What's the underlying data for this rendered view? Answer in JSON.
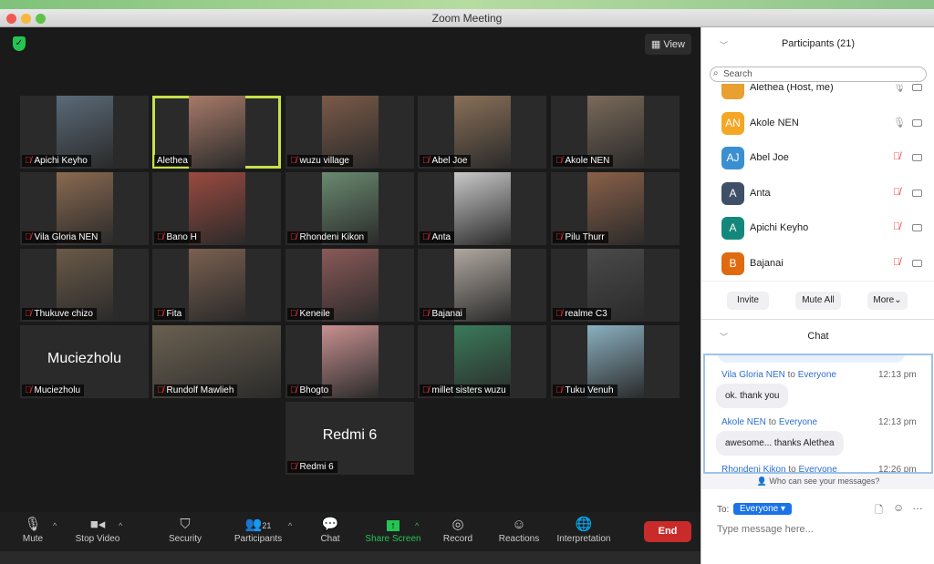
{
  "window": {
    "title": "Zoom Meeting"
  },
  "stage": {
    "view_label": "View",
    "active_speaker": "Alethea"
  },
  "tiles": [
    {
      "name": "Apichi Keyho",
      "muted": true,
      "bg": "#5a6a78"
    },
    {
      "name": "Alethea",
      "muted": false,
      "bg": "#a77a68",
      "active": true
    },
    {
      "name": "wuzu village",
      "muted": true,
      "bg": "#7a5a48"
    },
    {
      "name": "Abel Joe",
      "muted": true,
      "bg": "#8a7058"
    },
    {
      "name": "Akole NEN",
      "muted": true,
      "bg": "#7a6a5a"
    },
    {
      "name": "Vila Gloria NEN",
      "muted": true,
      "bg": "#8a6a50"
    },
    {
      "name": "Bano H",
      "muted": true,
      "bg": "#9a4a40"
    },
    {
      "name": "Rhondeni Kikon",
      "muted": true,
      "bg": "#6a8a70"
    },
    {
      "name": "Anta",
      "muted": true,
      "bg": "#c8c8c8"
    },
    {
      "name": "Pilu Thurr",
      "muted": true,
      "bg": "#8a6048"
    },
    {
      "name": "Thukuve chizo",
      "muted": true,
      "bg": "#6a5a48"
    },
    {
      "name": "Fita",
      "muted": true,
      "bg": "#7a6050"
    },
    {
      "name": "Keneile",
      "muted": true,
      "bg": "#8a5a58"
    },
    {
      "name": "Bajanai",
      "muted": true,
      "bg": "#b0a8a0"
    },
    {
      "name": "realme C3",
      "muted": true,
      "bg": "#4a4a4a"
    },
    {
      "name": "Muciezholu",
      "muted": true,
      "text_only": "Muciezholu"
    },
    {
      "name": "Rundolf Mawlieh",
      "muted": true,
      "bg": "#6a6050",
      "wide": true
    },
    {
      "name": "Bhogto",
      "muted": true,
      "bg": "#c89090"
    },
    {
      "name": "millet sisters wuzu",
      "muted": true,
      "bg": "#3a7a5a"
    },
    {
      "name": "Tuku Venuh",
      "muted": true,
      "bg": "#8ab0c0"
    },
    {
      "name": "Redmi 6",
      "muted": true,
      "text_only": "Redmi 6"
    }
  ],
  "toolbar": {
    "mute": "Mute",
    "stop_video": "Stop Video",
    "security": "Security",
    "participants": "Participants",
    "participant_count": "21",
    "chat": "Chat",
    "share_screen": "Share Screen",
    "record": "Record",
    "reactions": "Reactions",
    "interpretation": "Interpretation",
    "end": "End"
  },
  "participants_panel": {
    "title": "Participants (21)",
    "search_placeholder": "Search",
    "items": [
      {
        "name": "Alethea (Host, me)",
        "initials": "",
        "color": "#e8a030",
        "mic": "on"
      },
      {
        "name": "Akole NEN",
        "initials": "AN",
        "color": "#f5a623",
        "mic": "on"
      },
      {
        "name": "Abel Joe",
        "initials": "AJ",
        "color": "#3a8fd0",
        "mic": "muted"
      },
      {
        "name": "Anta",
        "initials": "A",
        "color": "#3d5068",
        "mic": "muted"
      },
      {
        "name": "Apichi Keyho",
        "initials": "A",
        "color": "#13887a",
        "mic": "muted"
      },
      {
        "name": "Bajanai",
        "initials": "B",
        "color": "#e06a10",
        "mic": "muted"
      }
    ],
    "invite": "Invite",
    "mute_all": "Mute All",
    "more": "More"
  },
  "chat_panel": {
    "title": "Chat",
    "messages": [
      {
        "from": "Vila Gloria NEN",
        "to": "Everyone",
        "time": "12:13 pm",
        "text": "ok. thank you"
      },
      {
        "from": "Akole NEN",
        "to": "Everyone",
        "time": "12:13 pm",
        "text": "awesome... thanks Alethea"
      },
      {
        "from": "Rhondeni Kikon",
        "to": "Everyone",
        "time": "12:26 pm",
        "text": ""
      }
    ],
    "to_word": "to",
    "who_can_see": "Who can see your messages?",
    "to_label": "To:",
    "recipient": "Everyone",
    "input_placeholder": "Type message here..."
  },
  "colors": {
    "accent": "#1a73e8",
    "end": "#c92b2b",
    "share": "#23c552",
    "muted": "#e33"
  }
}
